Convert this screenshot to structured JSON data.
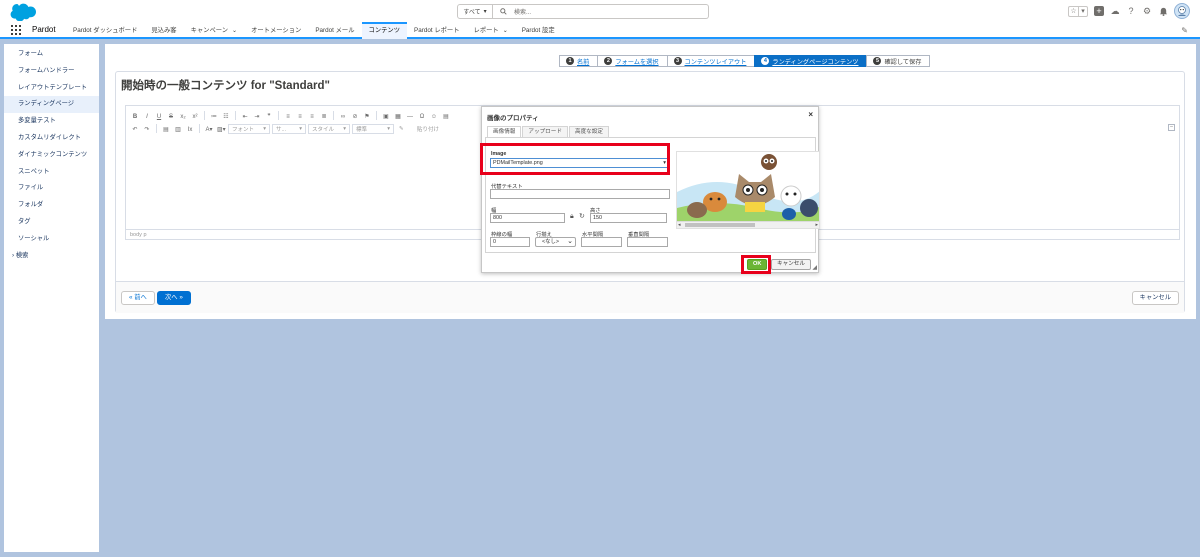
{
  "header": {
    "search_scope": "すべて",
    "search_placeholder": "検索..."
  },
  "nav": {
    "app_name": "Pardot",
    "items": [
      {
        "label": "Pardot ダッシュボード",
        "chevron": false
      },
      {
        "label": "見込み客",
        "chevron": false
      },
      {
        "label": "キャンペーン",
        "chevron": true
      },
      {
        "label": "オートメーション",
        "chevron": false
      },
      {
        "label": "Pardot メール",
        "chevron": false
      },
      {
        "label": "コンテンツ",
        "chevron": false,
        "active": true
      },
      {
        "label": "Pardot レポート",
        "chevron": false
      },
      {
        "label": "レポート",
        "chevron": true
      },
      {
        "label": "Pardot 設定",
        "chevron": false
      }
    ]
  },
  "sidebar": {
    "items": [
      {
        "label": "フォーム"
      },
      {
        "label": "フォームハンドラー"
      },
      {
        "label": "レイアウトテンプレート"
      },
      {
        "label": "ランディングページ",
        "active": true
      },
      {
        "label": "多変量テスト"
      },
      {
        "label": "カスタムリダイレクト"
      },
      {
        "label": "ダイナミックコンテンツ"
      },
      {
        "label": "スニペット"
      },
      {
        "label": "ファイル"
      },
      {
        "label": "フォルダ"
      },
      {
        "label": "タグ"
      },
      {
        "label": "ソーシャル"
      },
      {
        "label": "検索",
        "expand": true
      }
    ]
  },
  "wizard": {
    "steps": [
      {
        "num": "1",
        "label": "名前"
      },
      {
        "num": "2",
        "label": "フォームを選択"
      },
      {
        "num": "3",
        "label": "コンテンツレイアウト"
      },
      {
        "num": "4",
        "label": "ランディングページコンテンツ",
        "current": true
      },
      {
        "num": "5",
        "label": "確認して保存",
        "last": true
      }
    ]
  },
  "page": {
    "title": "開始時の一般コンテンツ for \"Standard\""
  },
  "editor": {
    "font_combo": "フォント",
    "size_combo": "サ...",
    "style_combo": "スタイル",
    "format_combo": "標準",
    "paste_label": "貼り付け",
    "path": "body  p"
  },
  "footer": {
    "prev_label": "« 前へ",
    "next_label": "次へ »",
    "cancel_label": "キャンセル"
  },
  "dialog": {
    "title": "画像のプロパティ",
    "tabs": [
      "画像情報",
      "アップロード",
      "高度な設定"
    ],
    "image_label": "Image",
    "image_value": "PDMailTemplate.png",
    "alt_label": "代替テキスト",
    "alt_value": "",
    "width_label": "幅",
    "width_value": "800",
    "height_label": "高さ",
    "height_value": "150",
    "border_label": "枠線の幅",
    "border_value": "0",
    "align_label": "行揃え",
    "align_value": "<なし>",
    "hspace_label": "水平間隔",
    "vspace_label": "垂直間隔",
    "ok_label": "OK",
    "cancel_label": "キャンセル"
  },
  "colors": {
    "brand": "#0070d2",
    "wizard_current": "#0b6fc6",
    "highlight_red": "#e8001b",
    "ok_green": "#6bb535",
    "background": "#b0c4df"
  }
}
